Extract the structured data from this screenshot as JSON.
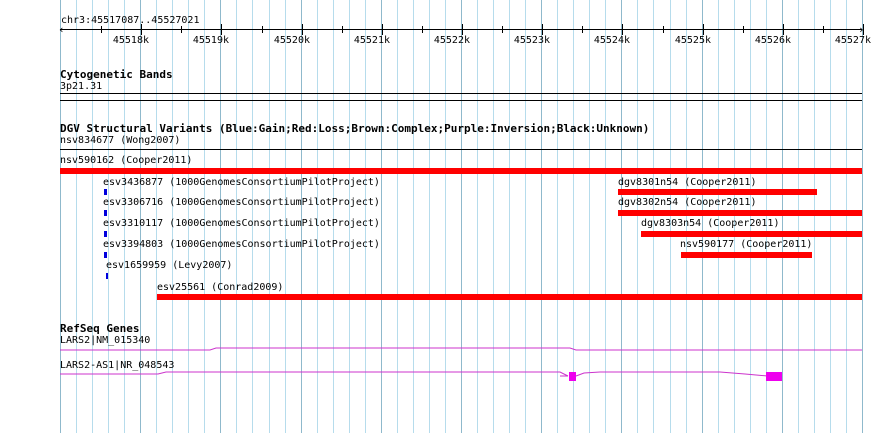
{
  "ruler": {
    "location": "chr3:45517087..45527021",
    "ticks": [
      "45518k",
      "45519k",
      "45520k",
      "45521k",
      "45522k",
      "45523k",
      "45524k",
      "45525k",
      "45526k",
      "45527k"
    ]
  },
  "cytobands": {
    "title": "Cytogenetic Bands",
    "band": "3p21.31"
  },
  "dgv": {
    "title": "DGV Structural Variants (Blue:Gain;Red:Loss;Brown:Complex;Purple:Inversion;Black:Unknown)",
    "features": {
      "nsv834677": "nsv834677 (Wong2007)",
      "nsv590162": "nsv590162 (Cooper2011)",
      "esv3436877": "esv3436877 (1000GenomesConsortiumPilotProject)",
      "esv3306716": "esv3306716 (1000GenomesConsortiumPilotProject)",
      "esv3310117": "esv3310117 (1000GenomesConsortiumPilotProject)",
      "esv3394803": "esv3394803 (1000GenomesConsortiumPilotProject)",
      "esv1659959": "esv1659959 (Levy2007)",
      "esv25561": "esv25561 (Conrad2009)",
      "dgv8301n54": "dgv8301n54 (Cooper2011)",
      "dgv8302n54": "dgv8302n54 (Cooper2011)",
      "dgv8303n54": "dgv8303n54 (Cooper2011)",
      "nsv590177": "nsv590177 (Cooper2011)"
    },
    "colors": {
      "loss": "#ff0000",
      "gain": "#0000dd"
    }
  },
  "refseq": {
    "title": "RefSeq Genes",
    "genes": {
      "lars2": "LARS2|NM_015340",
      "lars2_as1": "LARS2-AS1|NR_048543"
    },
    "color": "#ee00ee"
  }
}
